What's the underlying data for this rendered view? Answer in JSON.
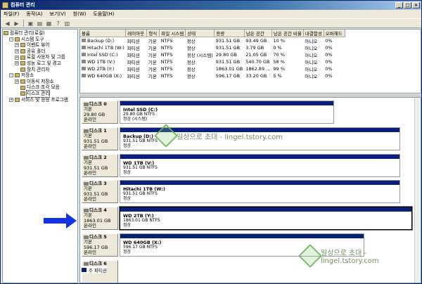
{
  "window": {
    "title": "컴퓨터 관리",
    "btn_min": "_",
    "btn_max": "□",
    "btn_close": "×"
  },
  "menu": [
    "파일(F)",
    "동작(A)",
    "보기(V)",
    "창(W)",
    "도움말(H)"
  ],
  "tree": [
    {
      "label": "컴퓨터 관리(로컬)",
      "lvl": 0
    },
    {
      "label": "시스템 도구",
      "lvl": 1,
      "box": "−"
    },
    {
      "label": "이벤트 뷰어",
      "lvl": 2,
      "box": "+"
    },
    {
      "label": "공유 폴더",
      "lvl": 2,
      "box": "+"
    },
    {
      "label": "로컬 사용자 및 그룹",
      "lvl": 2,
      "box": "+"
    },
    {
      "label": "성능 로그 및 경고",
      "lvl": 2,
      "box": "+"
    },
    {
      "label": "장치 관리자",
      "lvl": 2
    },
    {
      "label": "저장소",
      "lvl": 1,
      "box": "−"
    },
    {
      "label": "이동식 저장소",
      "lvl": 2,
      "box": "+"
    },
    {
      "label": "디스크 조각 모음",
      "lvl": 2
    },
    {
      "label": "디스크 관리",
      "lvl": 2,
      "sel": true
    },
    {
      "label": "서비스 및 응용 프로그램",
      "lvl": 1,
      "box": "+"
    }
  ],
  "vol_headers": [
    "볼륨",
    "레이아웃",
    "형식",
    "파일 시스템",
    "상태",
    "용량",
    "남은 공간",
    "남은 공간 비율",
    "내결함성",
    "오버헤드"
  ],
  "volumes": [
    [
      "Backup (D:)",
      "파티션",
      "기본",
      "NTFS",
      "정상",
      "931.51 GB",
      "93.49 GB",
      "10 %",
      "아니오",
      "0%"
    ],
    [
      "Hitachi 1TB (W:)",
      "파티션",
      "기본",
      "NTFS",
      "정상",
      "931.51 GB",
      "3.79 GB",
      "0 %",
      "아니오",
      "0%"
    ],
    [
      "Intel SSD (C:)",
      "파티션",
      "기본",
      "NTFS",
      "정상 (시스템)",
      "29.80 GB",
      "21.05 GB",
      "70 %",
      "아니오",
      "0%"
    ],
    [
      "WD 1TB (V:)",
      "파티션",
      "기본",
      "NTFS",
      "정상",
      "931.51 GB",
      "540.70 GB",
      "58 %",
      "아니오",
      "0%"
    ],
    [
      "WD 2TB (Y:)",
      "파티션",
      "기본",
      "NTFS",
      "정상",
      "1863.01 GB",
      "1862.89 ...",
      "99 %",
      "아니오",
      "0%"
    ],
    [
      "WD 640GB (X:)",
      "파티션",
      "기본",
      "NTFS",
      "정상",
      "596.17 GB",
      "33.20 GB",
      "5 %",
      "아니오",
      "0%"
    ]
  ],
  "disks": [
    {
      "name": "디스크 0",
      "type": "기본",
      "size": "29.80 GB",
      "status": "온라인",
      "pname": "Intel SSD  (C:)",
      "pinfo": "29.80 GB NTFS",
      "pstat": "정상 (시스템)",
      "width_frac": 0.72
    },
    {
      "name": "디스크 1",
      "type": "기본",
      "size": "931.51 GB",
      "status": "온라인",
      "pname": "Backup  (D:)",
      "pinfo": "931.51 GB NTFS",
      "pstat": "정상",
      "width_frac": 0.94
    },
    {
      "name": "디스크 2",
      "type": "기본",
      "size": "931.51 GB",
      "status": "온라인",
      "pname": "WD 1TB  (V:)",
      "pinfo": "931.51 GB NTFS",
      "pstat": "정상",
      "width_frac": 0.94
    },
    {
      "name": "디스크 3",
      "type": "기본",
      "size": "931.51 GB",
      "status": "온라인",
      "pname": "Hitachi 1TB  (W:)",
      "pinfo": "931.51 GB NTFS",
      "pstat": "정상",
      "width_frac": 0.94
    },
    {
      "name": "디스크 4",
      "type": "기본",
      "size": "1863.01 GB",
      "status": "온라인",
      "pname": "WD 2TB  (Y:)",
      "pinfo": "1863.01 GB NTFS",
      "pstat": "정상",
      "width_frac": 0.98,
      "sel": true
    },
    {
      "name": "디스크 5",
      "type": "기본",
      "size": "596.17 GB",
      "status": "온라인",
      "pname": "WD 640GB  (X:)",
      "pinfo": "596.17 GB NTFS",
      "pstat": "정상",
      "width_frac": 0.82
    },
    {
      "name": "디스크 6",
      "type": "",
      "size": "",
      "status": "",
      "pname": "",
      "pinfo": "",
      "pstat": "",
      "width_frac": 0
    }
  ],
  "legend": "주 파티션",
  "watermark": "일상으로 초대 - lingel.tstory.com",
  "colors": {
    "partition_band": "#0a1f7a",
    "arrow": "#1434e0",
    "title_bar": "#0a246a"
  }
}
